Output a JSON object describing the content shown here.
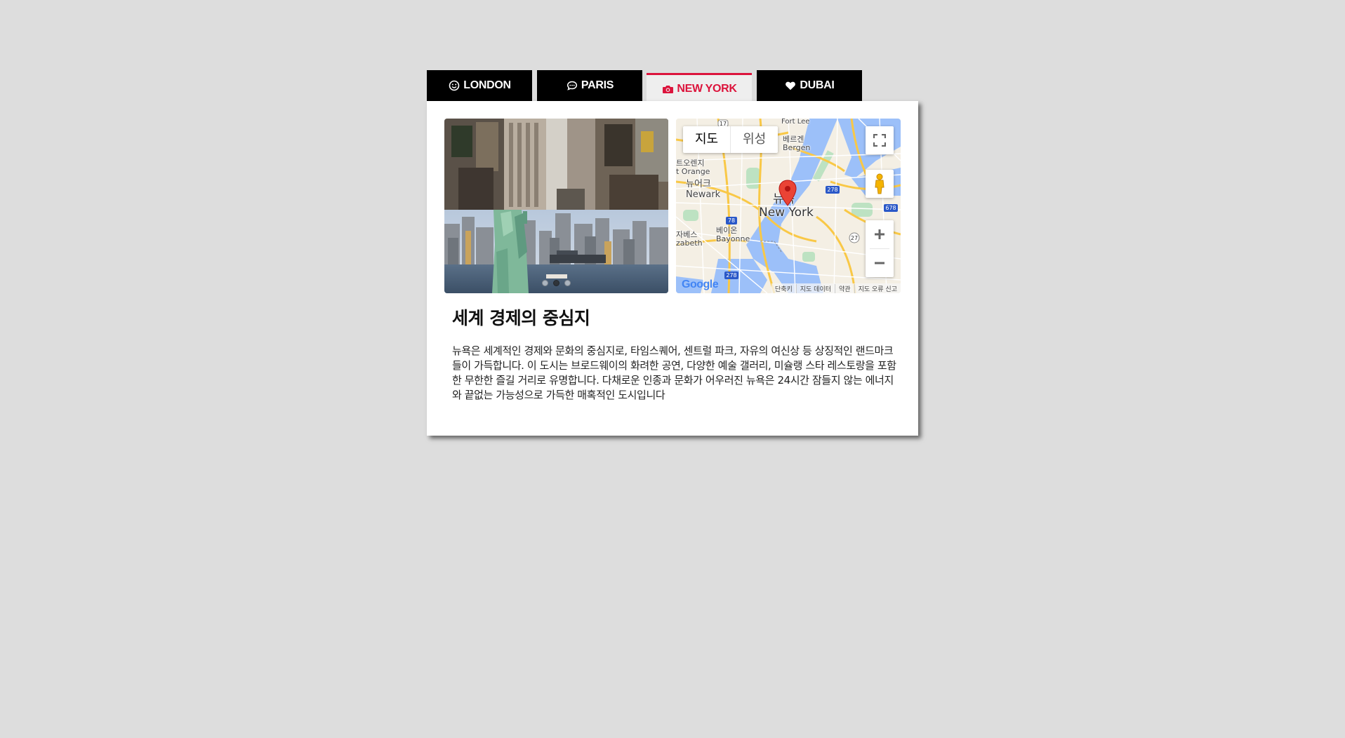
{
  "tabs": [
    {
      "label": "LONDON",
      "icon": "smile-icon",
      "active": false
    },
    {
      "label": "PARIS",
      "icon": "comment-icon",
      "active": false
    },
    {
      "label": "NEW YORK",
      "icon": "camera-icon",
      "active": true
    },
    {
      "label": "DUBAI",
      "icon": "heart-icon",
      "active": false
    }
  ],
  "colors": {
    "accent": "#dc143c",
    "tab_bg": "#000000",
    "page_bg": "#dddddd"
  },
  "slider": {
    "slide_count": 3,
    "active_index": 1
  },
  "map": {
    "type_map": "지도",
    "type_satellite": "위성",
    "marker_label_ko": "뉴욕",
    "marker_label_en": "New York",
    "labels": {
      "bergen_ko": "베르겐",
      "bergen": "Bergen",
      "orange_ko": "트오렌지",
      "orange": "t Orange",
      "newark_ko": "뉴어크",
      "newark": "Newark",
      "bayonne_ko": "베이온",
      "bayonne": "Bayonne",
      "elizabeth_ko": "자베스",
      "elizabeth": "zabeth",
      "fort_lee": "Fort Lee",
      "route_17": "17",
      "route_78": "78",
      "route_278a": "278",
      "route_678": "678",
      "route_278b": "278",
      "route_27": "27"
    },
    "footer": [
      "단축키",
      "지도 데이터",
      "약관",
      "지도 오류 신고"
    ],
    "logo": "Google"
  },
  "content": {
    "heading": "세계 경제의 중심지",
    "description": "뉴욕은 세계적인 경제와 문화의 중심지로, 타임스퀘어, 센트럴 파크, 자유의 여신상 등 상징적인 랜드마크들이 가득합니다. 이 도시는 브로드웨이의 화려한 공연, 다양한 예술 갤러리, 미슐랭 스타 레스토랑을 포함한 무한한 즐길 거리로 유명합니다. 다채로운 인종과 문화가 어우러진 뉴욕은 24시간 잠들지 않는 에너지와 끝없는 가능성으로 가득한 매혹적인 도시입니다"
  }
}
